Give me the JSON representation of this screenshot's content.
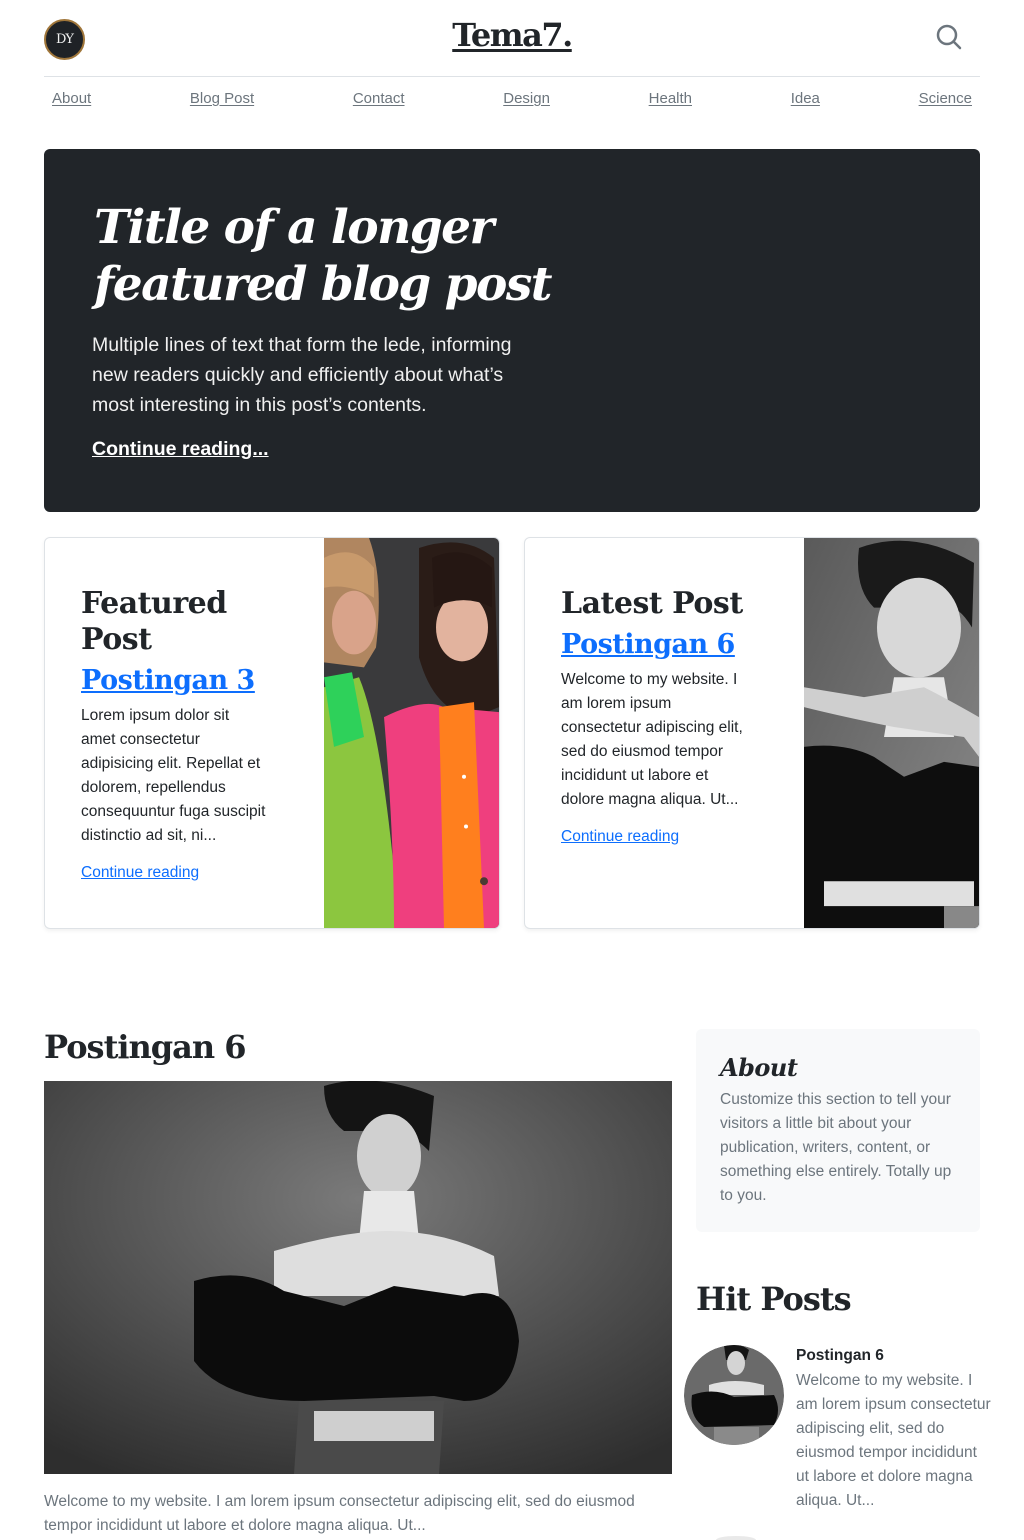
{
  "header": {
    "logo_text": "DY",
    "brand": "Tema7.",
    "search_icon": "search-icon"
  },
  "nav": {
    "items": [
      {
        "label": "About"
      },
      {
        "label": "Blog Post"
      },
      {
        "label": "Contact"
      },
      {
        "label": "Design"
      },
      {
        "label": "Health"
      },
      {
        "label": "Idea"
      },
      {
        "label": "Science"
      }
    ]
  },
  "hero": {
    "title": "Title of a longer featured blog post",
    "lede": "Multiple lines of text that form the lede, informing new readers quickly and efficiently about what’s most interesting in this post’s contents.",
    "link": "Continue reading..."
  },
  "cards": [
    {
      "heading": "Featured Post",
      "post_title": "Postingan 3",
      "excerpt": "Lorem ipsum dolor sit amet consectetur adipisicing elit. Repellat et dolorem, repellendus consequuntur fuga suscipit distinctio ad sit, ni...",
      "link": "Continue reading"
    },
    {
      "heading": "Latest Post",
      "post_title": "Postingan 6",
      "excerpt": "Welcome to my website. I am lorem ipsum consectetur adipiscing elit, sed do eiusmod tempor incididunt ut labore et dolore magna aliqua. Ut...",
      "link": "Continue reading"
    }
  ],
  "main_post": {
    "title": "Postingan 6",
    "excerpt": "Welcome to my website. I am lorem ipsum consectetur adipiscing elit, sed do eiusmod tempor incididunt ut labore et dolore magna aliqua. Ut..."
  },
  "sidebar": {
    "about": {
      "title": "About",
      "text": "Customize this section to tell your visitors a little bit about your publication, writers, content, or something else entirely. Totally up to you."
    },
    "hit_posts": {
      "title": "Hit Posts",
      "items": [
        {
          "title": "Postingan 6",
          "excerpt": "Welcome to my website. I am lorem ipsum consectetur adipiscing elit, sed do eiusmod tempor incididunt ut labore et dolore magna aliqua. Ut..."
        }
      ]
    }
  },
  "colors": {
    "accent": "#0d6efd",
    "hero_bg": "#212529",
    "muted": "#6c757d",
    "panel_bg": "#f8f9fa"
  }
}
